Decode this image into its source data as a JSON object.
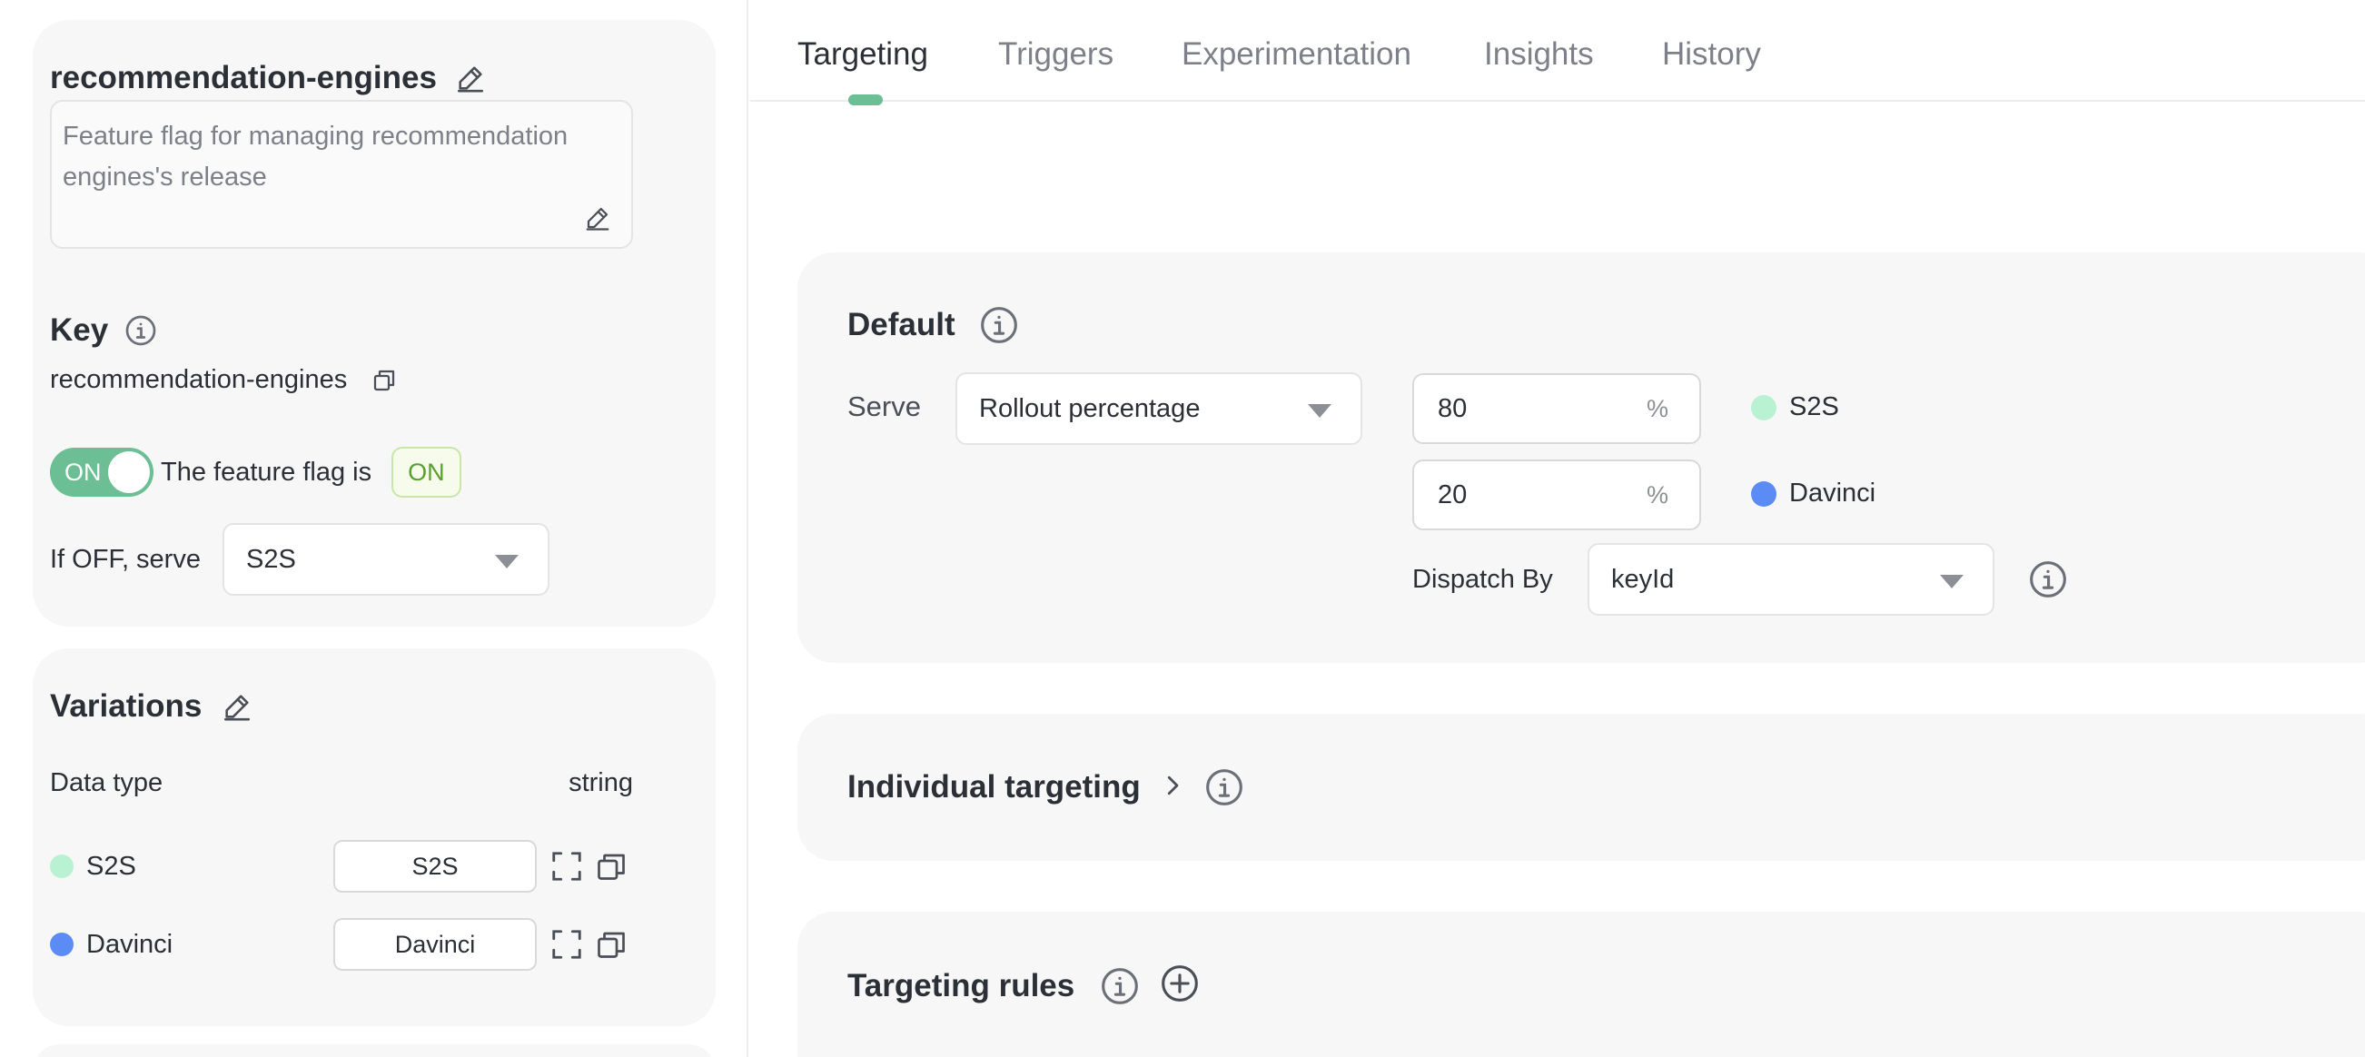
{
  "flag": {
    "name": "recommendation-engines",
    "description": "Feature flag for managing recommendation engines's release",
    "key_label": "Key",
    "key_value": "recommendation-engines",
    "toggle_label": "ON",
    "status_text": "The feature flag is",
    "status_badge": "ON",
    "off_serve_label": "If OFF, serve",
    "off_serve_value": "S2S"
  },
  "variations": {
    "title": "Variations",
    "data_type_label": "Data type",
    "data_type_value": "string",
    "items": [
      {
        "name": "S2S",
        "value": "S2S",
        "color": "#b9f2d2"
      },
      {
        "name": "Davinci",
        "value": "Davinci",
        "color": "#5b8cf5"
      }
    ]
  },
  "tabs": [
    {
      "label": "Targeting",
      "active": true
    },
    {
      "label": "Triggers",
      "active": false
    },
    {
      "label": "Experimentation",
      "active": false
    },
    {
      "label": "Insights",
      "active": false
    },
    {
      "label": "History",
      "active": false
    }
  ],
  "default_section": {
    "title": "Default",
    "serve_label": "Serve",
    "serve_mode": "Rollout percentage",
    "allocations": [
      {
        "percent": "80",
        "unit": "%",
        "variation": "S2S",
        "color": "#b9f2d2"
      },
      {
        "percent": "20",
        "unit": "%",
        "variation": "Davinci",
        "color": "#5b8cf5"
      }
    ],
    "dispatch_label": "Dispatch By",
    "dispatch_value": "keyId"
  },
  "individual_targeting": {
    "title": "Individual targeting"
  },
  "targeting_rules": {
    "title": "Targeting rules"
  },
  "colors": {
    "accent": "#6cbe94",
    "badge_text": "#5aa02c",
    "card_bg": "#f7f7f8"
  },
  "icons": [
    "edit-icon",
    "info-icon",
    "copy-icon",
    "expand-icon",
    "chevron-right-icon",
    "add-circle-icon",
    "caret-down-icon"
  ]
}
